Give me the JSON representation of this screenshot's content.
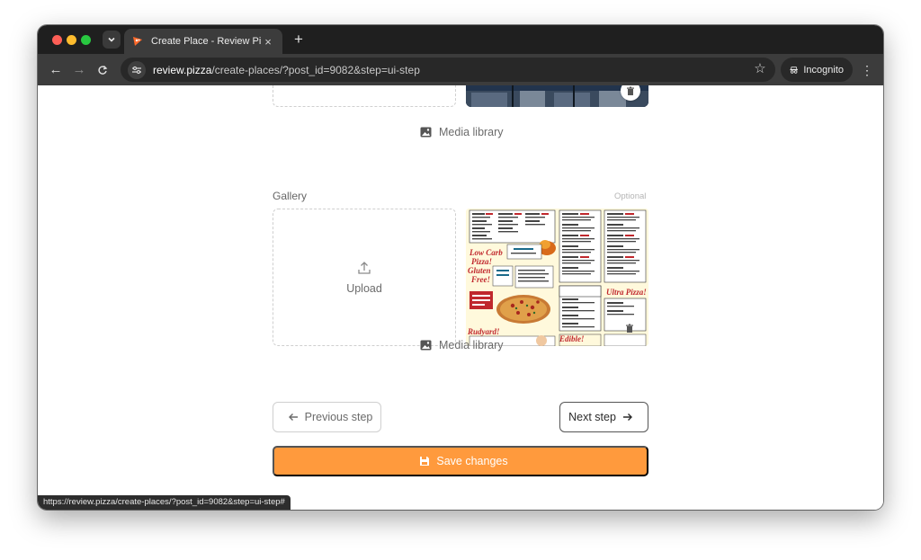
{
  "browser": {
    "tab_title": "Create Place - Review Pizza",
    "url_host": "review.pizza",
    "url_path": "/create-places/?post_id=9082&step=ui-step",
    "incognito_label": "Incognito",
    "status_url": "https://review.pizza/create-places/?post_id=9082&step=ui-step#"
  },
  "form": {
    "media_library_label": "Media library",
    "gallery": {
      "label": "Gallery",
      "optional_label": "Optional",
      "upload_label": "Upload",
      "media_library_label": "Media library"
    }
  },
  "actions": {
    "previous_label": "Previous step",
    "next_label": "Next step",
    "save_label": "Save changes"
  },
  "colors": {
    "accent": "#ff9a3d",
    "chrome_dark": "#1f1f1f",
    "toolbar": "#3c3c3c"
  }
}
